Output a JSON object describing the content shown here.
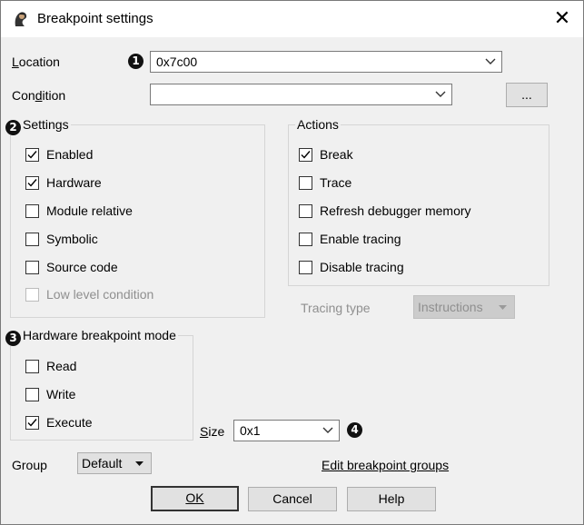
{
  "window": {
    "title": "Breakpoint settings",
    "close_glyph": "✕",
    "icon": "debugger-app-icon"
  },
  "location": {
    "label": "Location",
    "marker": "1",
    "value": "0x7c00"
  },
  "condition": {
    "label": "Condition",
    "value": "",
    "browse_label": "..."
  },
  "settings": {
    "marker": "2",
    "title": "Settings",
    "items": [
      {
        "label": "Enabled",
        "checked": true,
        "enabled": true
      },
      {
        "label": "Hardware",
        "checked": true,
        "enabled": true
      },
      {
        "label": "Module relative",
        "checked": false,
        "enabled": true
      },
      {
        "label": "Symbolic",
        "checked": false,
        "enabled": true
      },
      {
        "label": "Source code",
        "checked": false,
        "enabled": true
      },
      {
        "label": "Low level condition",
        "checked": false,
        "enabled": false
      }
    ]
  },
  "actions": {
    "title": "Actions",
    "items": [
      {
        "label": "Break",
        "checked": true,
        "enabled": true
      },
      {
        "label": "Trace",
        "checked": false,
        "enabled": true
      },
      {
        "label": "Refresh debugger memory",
        "checked": false,
        "enabled": true
      },
      {
        "label": "Enable tracing",
        "checked": false,
        "enabled": true
      },
      {
        "label": "Disable tracing",
        "checked": false,
        "enabled": true
      }
    ]
  },
  "tracing_type": {
    "label": "Tracing type",
    "value": "Instructions",
    "enabled": false
  },
  "hw_mode": {
    "marker": "3",
    "title": "Hardware breakpoint mode",
    "items": [
      {
        "label": "Read",
        "checked": false,
        "enabled": true
      },
      {
        "label": "Write",
        "checked": false,
        "enabled": true
      },
      {
        "label": "Execute",
        "checked": true,
        "enabled": true
      }
    ]
  },
  "size": {
    "label": "Size",
    "value": "0x1",
    "marker": "4"
  },
  "group": {
    "label": "Group",
    "value": "Default"
  },
  "edit_groups_link": "Edit breakpoint groups",
  "buttons": {
    "ok": "OK",
    "cancel": "Cancel",
    "help": "Help"
  },
  "colors": {
    "dialog_bg": "#f0f0f0",
    "titlebar_bg": "#ffffff",
    "disabled_text": "#8f8f8f",
    "marker_bg": "#111111"
  }
}
